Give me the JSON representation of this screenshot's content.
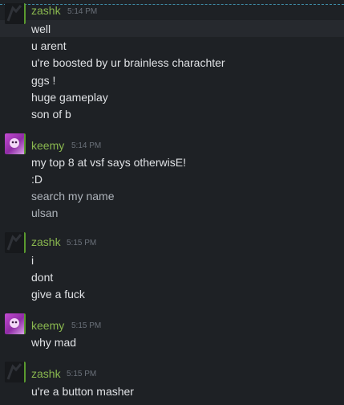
{
  "messages": [
    {
      "author": "zashk",
      "time": "5:14 PM",
      "lines": [
        "well",
        "u arent",
        "u're boosted by ur brainless charachter",
        "ggs !",
        "huge gameplay",
        "son of b"
      ]
    },
    {
      "author": "keemy",
      "time": "5:14 PM",
      "lines": [
        "my top 8 at vsf says otherwisE!",
        ":D",
        "search my name",
        "ulsan"
      ]
    },
    {
      "author": "zashk",
      "time": "5:15 PM",
      "lines": [
        "i",
        "dont",
        "give a fuck"
      ]
    },
    {
      "author": "keemy",
      "time": "5:15 PM",
      "lines": [
        "why mad"
      ]
    },
    {
      "author": "zashk",
      "time": "5:15 PM",
      "lines": [
        "u're a button masher"
      ]
    }
  ],
  "colors": {
    "background": "#1e2125",
    "username": "#8ab84f",
    "timestamp": "#6b717a",
    "text": "#dfe1e4"
  }
}
